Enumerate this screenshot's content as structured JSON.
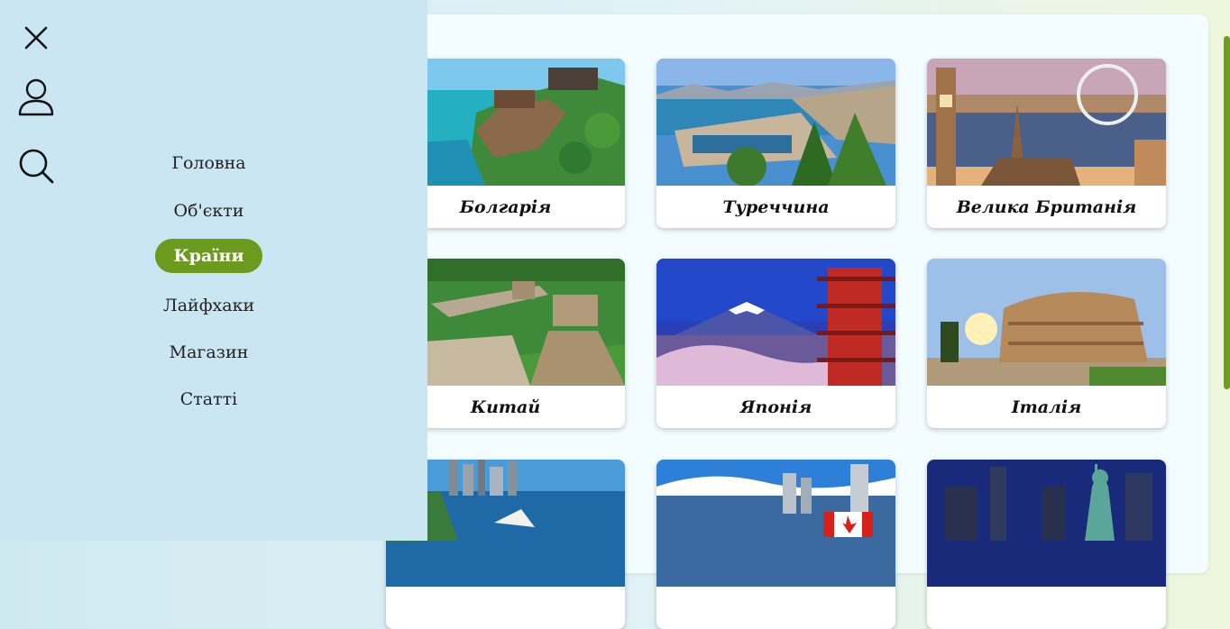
{
  "menu": {
    "close_icon": "close-icon",
    "user_icon": "user-icon",
    "search_icon": "search-icon",
    "items": [
      {
        "label": "Головна",
        "active": false
      },
      {
        "label": "Об'єкти",
        "active": false
      },
      {
        "label": "Країни",
        "active": true
      },
      {
        "label": "Лайфхаки",
        "active": false
      },
      {
        "label": "Магазин",
        "active": false
      },
      {
        "label": "Статті",
        "active": false
      }
    ]
  },
  "colors": {
    "drawer_bg": "#cae6f2",
    "accent": "#6b9a1c",
    "panel_bg": "#f3fcfe"
  },
  "countries": [
    {
      "name": "Болгарія"
    },
    {
      "name": "Туреччина"
    },
    {
      "name": "Велика Британія"
    },
    {
      "name": "Китай"
    },
    {
      "name": "Японія"
    },
    {
      "name": "Італія"
    },
    {
      "name": ""
    },
    {
      "name": ""
    },
    {
      "name": ""
    }
  ]
}
